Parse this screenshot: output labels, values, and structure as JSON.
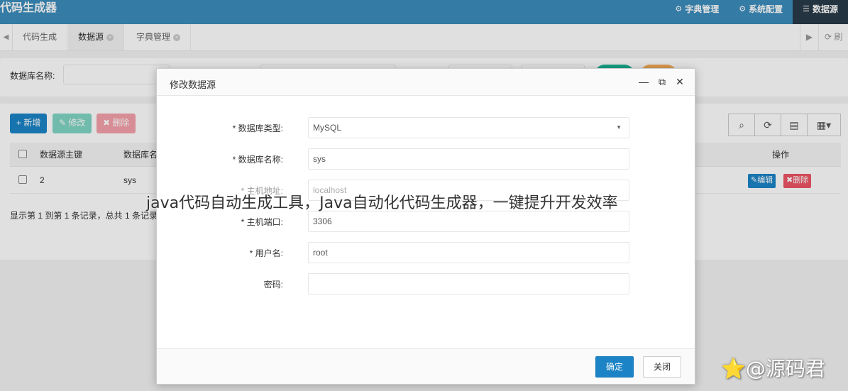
{
  "app": {
    "title": "代码生成器"
  },
  "topnav": [
    {
      "icon": "gear-icon",
      "glyph": "⚙",
      "label": "字典管理"
    },
    {
      "icon": "gear-icon",
      "glyph": "⚙",
      "label": "系统配置"
    },
    {
      "icon": "database-icon",
      "glyph": "☰",
      "label": "数据源"
    }
  ],
  "tabs": [
    {
      "label": "代码生成"
    },
    {
      "label": "数据源"
    },
    {
      "label": "字典管理"
    }
  ],
  "tabs_right": {
    "refresh": "⟳ 刷新"
  },
  "search": {
    "db_name_label": "数据库名称:"
  },
  "toolbar": {
    "add": "+ 新增",
    "edit": "✎ 修改",
    "delete": "✖ 删除"
  },
  "table": {
    "headers": {
      "pk": "数据源主键",
      "dbname": "数据库名",
      "ops": "操作"
    },
    "rows": [
      {
        "pk": "2",
        "dbname": "sys",
        "edit": "✎编辑",
        "delete": "✖删除"
      }
    ],
    "footer": "显示第 1 到第 1 条记录，总共 1 条记录"
  },
  "modal": {
    "title": "修改数据源",
    "fields": [
      {
        "label": "* 数据库类型:",
        "value": "MySQL",
        "type": "select"
      },
      {
        "label": "* 数据库名称:",
        "value": "sys"
      },
      {
        "label": "* 主机地址:",
        "value": "localhost",
        "placeholder": true
      },
      {
        "label": "* 主机端口:",
        "value": "3306"
      },
      {
        "label": "* 用户名:",
        "value": "root"
      },
      {
        "label": "密码:",
        "value": ""
      }
    ],
    "ok": "确定",
    "close": "关闭"
  },
  "overlay_caption": "java代码自动生成工具，Java自动化代码生成器，一键提升开发效率",
  "source_watermark": "⭐@源码君",
  "colors": {
    "topbar": "#3c8dbc",
    "primary": "#1c84c6",
    "success": "#1ab394",
    "danger": "#ed5565"
  }
}
